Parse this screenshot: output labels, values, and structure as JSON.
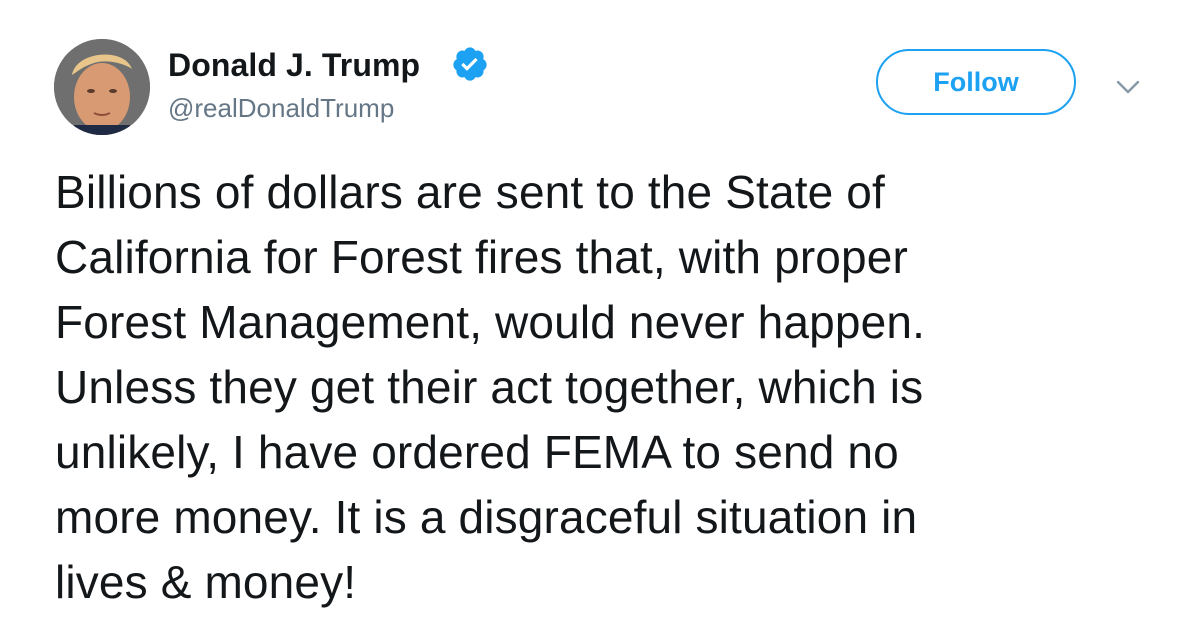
{
  "author": {
    "display_name": "Donald J. Trump",
    "handle": "@realDonaldTrump",
    "avatar_icon": "profile-photo",
    "verified_icon": "verified-badge-icon"
  },
  "actions": {
    "follow_label": "Follow",
    "menu_icon": "chevron-down-icon"
  },
  "tweet": {
    "lines": [
      "Billions of dollars are sent to the State of",
      "California for Forest fires that, with proper",
      "Forest Management, would never happen.",
      "Unless they get their act together, which is",
      "unlikely, I have ordered FEMA to send no",
      "more money. It is a disgraceful situation in",
      "lives & money!"
    ]
  },
  "colors": {
    "accent": "#1da1f2",
    "text_primary": "#14171a",
    "text_secondary": "#657786",
    "background": "#ffffff"
  }
}
